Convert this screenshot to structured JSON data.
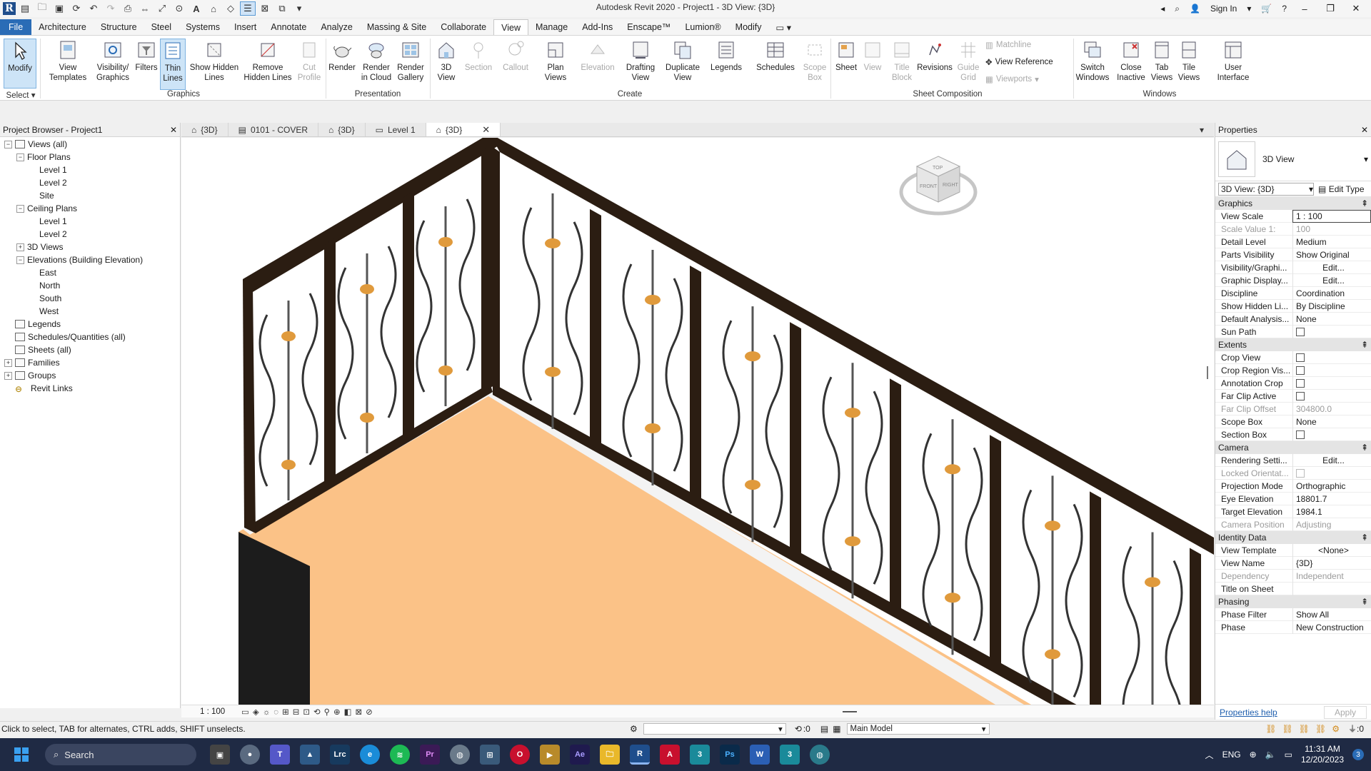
{
  "app": {
    "title": "Autodesk Revit 2020 - Project1 - 3D View: {3D}",
    "sign_in": "Sign In",
    "logo_letter": "R"
  },
  "ribbon_tabs": [
    "File",
    "Architecture",
    "Structure",
    "Steel",
    "Systems",
    "Insert",
    "Annotate",
    "Analyze",
    "Massing & Site",
    "Collaborate",
    "View",
    "Manage",
    "Add-Ins",
    "Enscape™",
    "Lumion®",
    "Modify"
  ],
  "ribbon": {
    "modify": "Modify",
    "select": "Select",
    "view_templates": "View Templates",
    "visibility_graphics": "Visibility/ Graphics",
    "filters": "Filters",
    "thin_lines": "Thin Lines",
    "show_hidden_lines": "Show Hidden Lines",
    "remove_hidden_lines": "Remove Hidden Lines",
    "cut_profile": "Cut Profile",
    "render": "Render",
    "render_in_cloud": "Render in Cloud",
    "render_gallery": "Render Gallery",
    "view_3d": "3D View",
    "section": "Section",
    "callout": "Callout",
    "plan_views": "Plan Views",
    "elevation": "Elevation",
    "drafting_view": "Drafting View",
    "duplicate_view": "Duplicate View",
    "legends": "Legends",
    "schedules": "Schedules",
    "scope_box": "Scope Box",
    "sheet": "Sheet",
    "view": "View",
    "title_block": "Title Block",
    "revisions": "Revisions",
    "guide_grid": "Guide Grid",
    "matchline": "Matchline",
    "view_reference": "View  Reference",
    "viewports": "Viewports",
    "switch_windows": "Switch Windows",
    "close_inactive": "Close Inactive",
    "tab_views": "Tab Views",
    "tile_views": "Tile Views",
    "user_interface": "User Interface",
    "groups": {
      "graphics": "Graphics",
      "presentation": "Presentation",
      "create": "Create",
      "sheet_composition": "Sheet Composition",
      "windows": "Windows"
    }
  },
  "browser": {
    "title": "Project Browser - Project1",
    "nodes": [
      {
        "label": "Views (all)",
        "level": 0,
        "toggle": "−",
        "icon": true
      },
      {
        "label": "Floor Plans",
        "level": 1,
        "toggle": "−"
      },
      {
        "label": "Level 1",
        "level": 2
      },
      {
        "label": "Level 2",
        "level": 2
      },
      {
        "label": "Site",
        "level": 2
      },
      {
        "label": "Ceiling Plans",
        "level": 1,
        "toggle": "−"
      },
      {
        "label": "Level 1",
        "level": 2
      },
      {
        "label": "Level 2",
        "level": 2
      },
      {
        "label": "3D Views",
        "level": 1,
        "toggle": "+"
      },
      {
        "label": "Elevations (Building Elevation)",
        "level": 1,
        "toggle": "−"
      },
      {
        "label": "East",
        "level": 2
      },
      {
        "label": "North",
        "level": 2
      },
      {
        "label": "South",
        "level": 2
      },
      {
        "label": "West",
        "level": 2
      },
      {
        "label": "Legends",
        "level": 0,
        "icon": true
      },
      {
        "label": "Schedules/Quantities (all)",
        "level": 0,
        "icon": true
      },
      {
        "label": "Sheets (all)",
        "level": 0,
        "icon": true
      },
      {
        "label": "Families",
        "level": 0,
        "toggle": "+",
        "icon": true
      },
      {
        "label": "Groups",
        "level": 0,
        "toggle": "+",
        "icon": true
      },
      {
        "label": "Revit Links",
        "level": 0,
        "link": true
      }
    ]
  },
  "view_tabs": [
    "{3D}",
    "0101 - COVER",
    "{3D}",
    "Level 1",
    "{3D}"
  ],
  "view_bar": {
    "scale": "1 : 100"
  },
  "properties": {
    "title": "Properties",
    "type_name": "3D View",
    "instance": "3D View: {3D}",
    "edit_type": "Edit Type",
    "sections": [
      {
        "name": "Graphics",
        "rows": [
          {
            "k": "View Scale",
            "v": "1 : 100",
            "style": "boxed"
          },
          {
            "k": "Scale Value    1:",
            "v": "100",
            "dis": true
          },
          {
            "k": "Detail Level",
            "v": "Medium"
          },
          {
            "k": "Parts Visibility",
            "v": "Show Original"
          },
          {
            "k": "Visibility/Graphi...",
            "v": "Edit...",
            "style": "btn"
          },
          {
            "k": "Graphic Display...",
            "v": "Edit...",
            "style": "btn"
          },
          {
            "k": "Discipline",
            "v": "Coordination"
          },
          {
            "k": "Show Hidden Li...",
            "v": "By Discipline"
          },
          {
            "k": "Default Analysis...",
            "v": "None"
          },
          {
            "k": "Sun Path",
            "check": true
          }
        ]
      },
      {
        "name": "Extents",
        "rows": [
          {
            "k": "Crop View",
            "check": true
          },
          {
            "k": "Crop Region Vis...",
            "check": true
          },
          {
            "k": "Annotation Crop",
            "check": true
          },
          {
            "k": "Far Clip Active",
            "check": true
          },
          {
            "k": "Far Clip Offset",
            "v": "304800.0",
            "dis": true
          },
          {
            "k": "Scope Box",
            "v": "None"
          },
          {
            "k": "Section Box",
            "check": true
          }
        ]
      },
      {
        "name": "Camera",
        "rows": [
          {
            "k": "Rendering Setti...",
            "v": "Edit...",
            "style": "btn"
          },
          {
            "k": "Locked Orientat...",
            "check": true,
            "dis": true
          },
          {
            "k": "Projection Mode",
            "v": "Orthographic"
          },
          {
            "k": "Eye Elevation",
            "v": "18801.7"
          },
          {
            "k": "Target Elevation",
            "v": "1984.1"
          },
          {
            "k": "Camera Position",
            "v": "Adjusting",
            "dis": true
          }
        ]
      },
      {
        "name": "Identity Data",
        "rows": [
          {
            "k": "View Template",
            "v": "<None>",
            "style": "btn"
          },
          {
            "k": "View Name",
            "v": "{3D}"
          },
          {
            "k": "Dependency",
            "v": "Independent",
            "dis": true
          },
          {
            "k": "Title on Sheet",
            "v": ""
          }
        ]
      },
      {
        "name": "Phasing",
        "rows": [
          {
            "k": "Phase Filter",
            "v": "Show All"
          },
          {
            "k": "Phase",
            "v": "New Construction"
          }
        ]
      }
    ],
    "help": "Properties help",
    "apply": "Apply"
  },
  "status": {
    "hint": "Click to select, TAB for alternates, CTRL adds, SHIFT unselects.",
    "count": ":0",
    "model": "Main Model",
    "filter_count": ":0"
  },
  "taskbar": {
    "search": "Search",
    "lang": "ENG",
    "time": "11:31 AM",
    "date": "12/20/2023",
    "badge": "3"
  },
  "viewcube": {
    "top": "TOP",
    "front": "FRONT",
    "right": "RIGHT"
  },
  "colors": {
    "accent": "#2a6cb6",
    "floor": "#fbc287",
    "rail": "#2b1d12",
    "knot": "#e09a3c"
  }
}
